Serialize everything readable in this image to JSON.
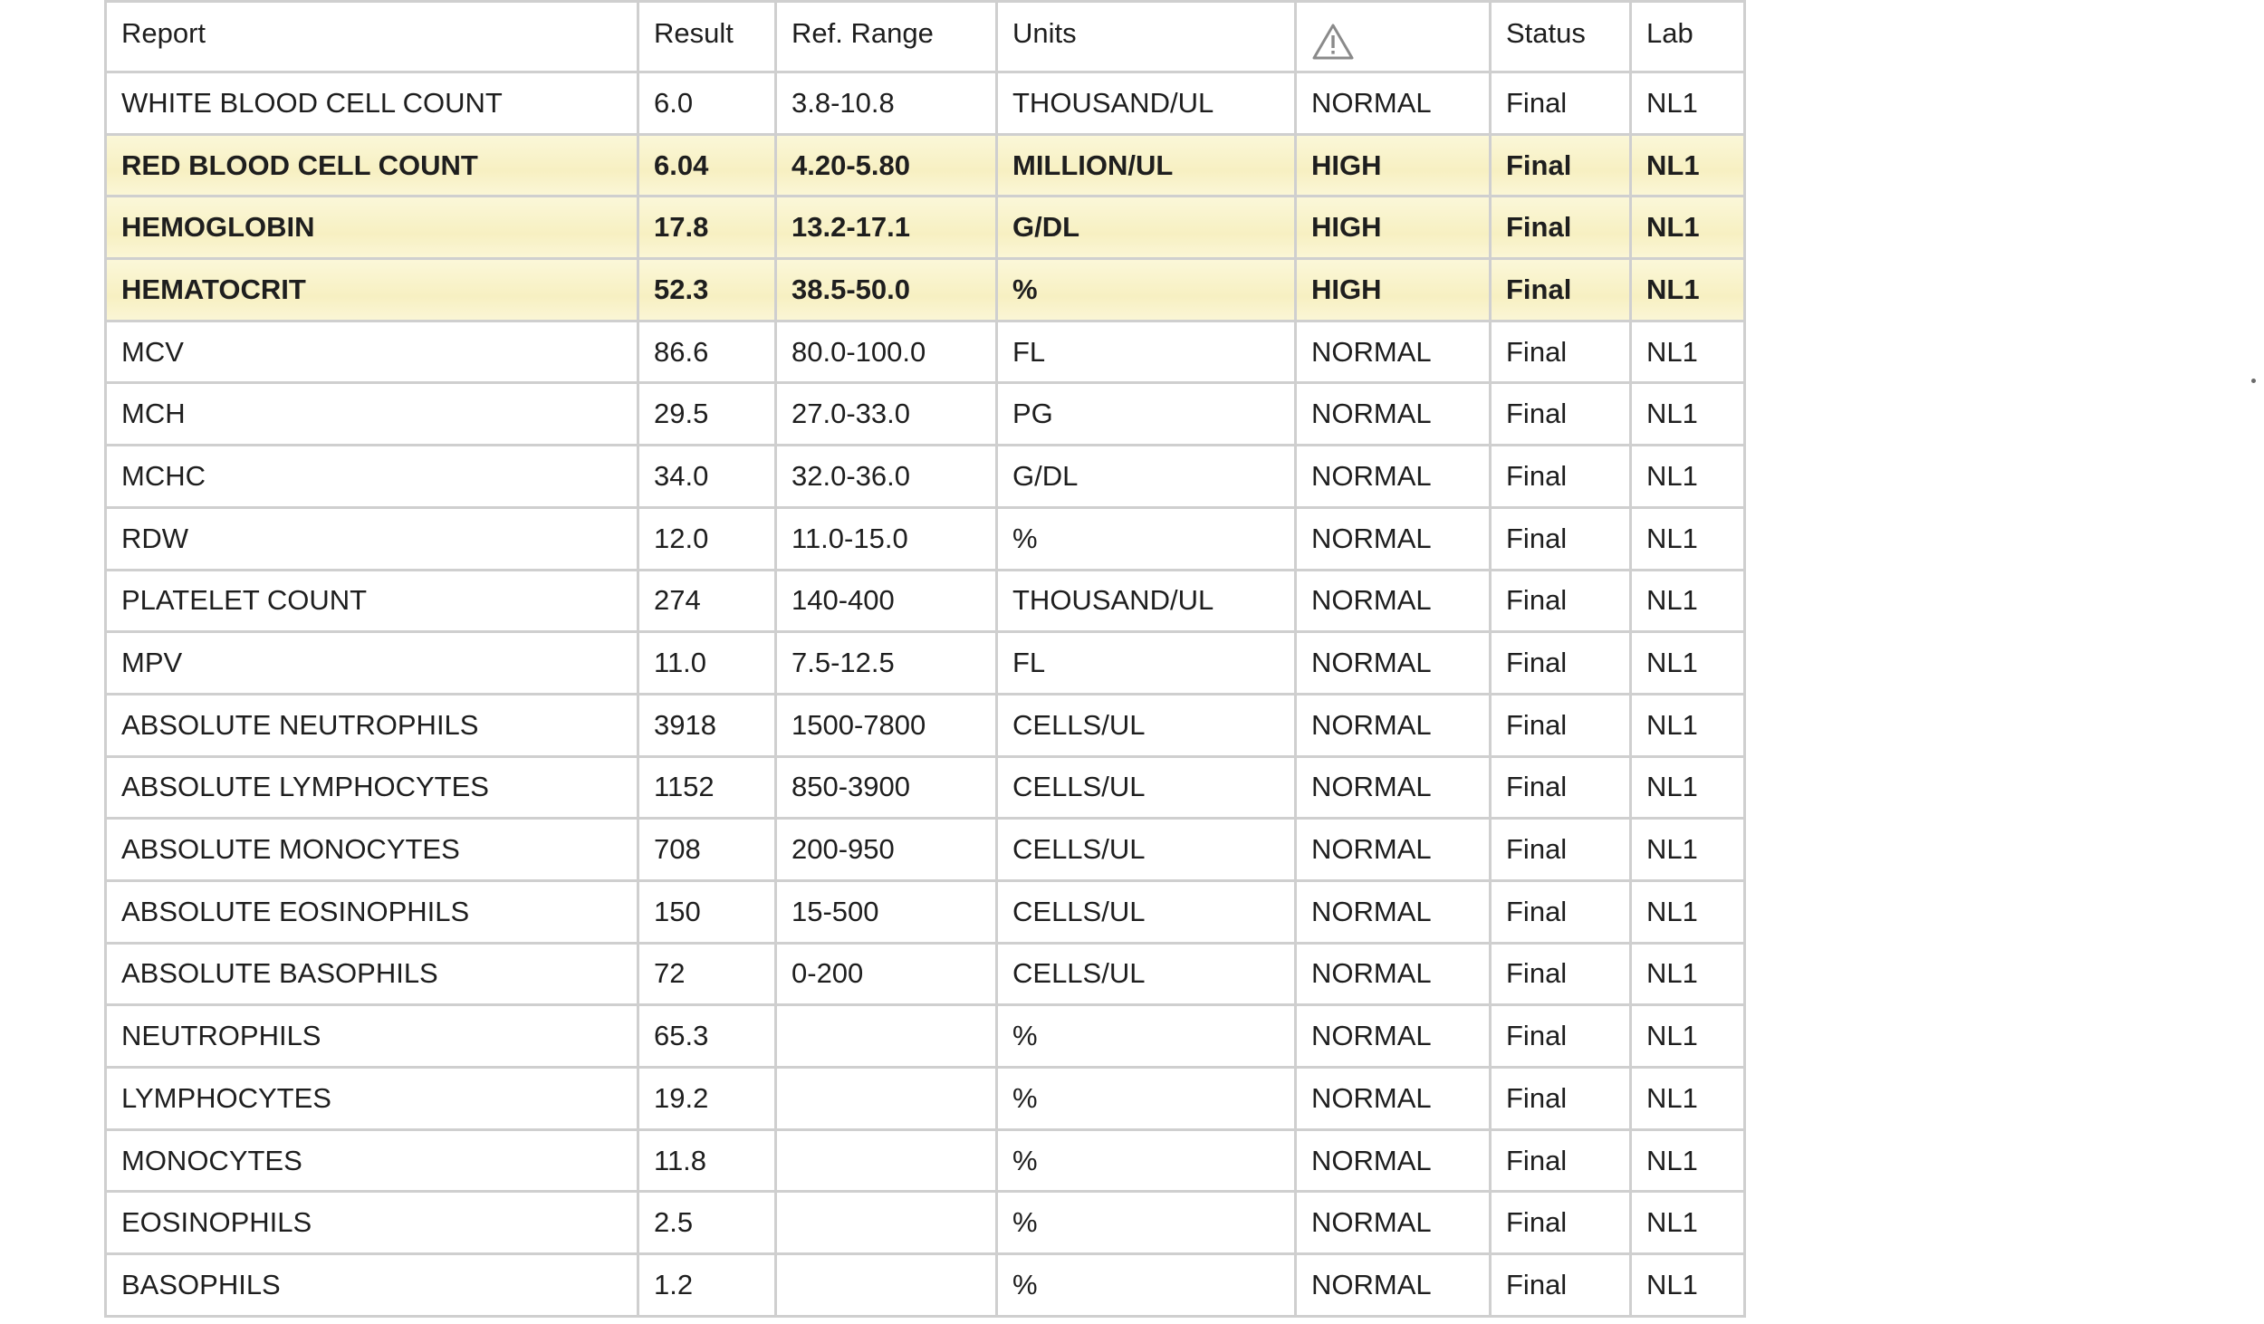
{
  "table": {
    "headers": {
      "report": "Report",
      "result": "Result",
      "ref_range": "Ref. Range",
      "units": "Units",
      "flag_icon": "warning-triangle-icon",
      "status": "Status",
      "lab": "Lab"
    },
    "rows": [
      {
        "report": "WHITE BLOOD CELL COUNT",
        "result": "6.0",
        "ref_range": "3.8-10.8",
        "units": "THOUSAND/UL",
        "flag": "NORMAL",
        "status": "Final",
        "lab": "NL1"
      },
      {
        "report": "RED BLOOD CELL COUNT",
        "result": "6.04",
        "ref_range": "4.20-5.80",
        "units": "MILLION/UL",
        "flag": "HIGH",
        "status": "Final",
        "lab": "NL1"
      },
      {
        "report": "HEMOGLOBIN",
        "result": "17.8",
        "ref_range": "13.2-17.1",
        "units": "G/DL",
        "flag": "HIGH",
        "status": "Final",
        "lab": "NL1"
      },
      {
        "report": "HEMATOCRIT",
        "result": "52.3",
        "ref_range": "38.5-50.0",
        "units": "%",
        "flag": "HIGH",
        "status": "Final",
        "lab": "NL1"
      },
      {
        "report": "MCV",
        "result": "86.6",
        "ref_range": "80.0-100.0",
        "units": "FL",
        "flag": "NORMAL",
        "status": "Final",
        "lab": "NL1"
      },
      {
        "report": "MCH",
        "result": "29.5",
        "ref_range": "27.0-33.0",
        "units": "PG",
        "flag": "NORMAL",
        "status": "Final",
        "lab": "NL1"
      },
      {
        "report": "MCHC",
        "result": "34.0",
        "ref_range": "32.0-36.0",
        "units": "G/DL",
        "flag": "NORMAL",
        "status": "Final",
        "lab": "NL1"
      },
      {
        "report": "RDW",
        "result": "12.0",
        "ref_range": "11.0-15.0",
        "units": "%",
        "flag": "NORMAL",
        "status": "Final",
        "lab": "NL1"
      },
      {
        "report": "PLATELET COUNT",
        "result": "274",
        "ref_range": "140-400",
        "units": "THOUSAND/UL",
        "flag": "NORMAL",
        "status": "Final",
        "lab": "NL1"
      },
      {
        "report": "MPV",
        "result": "11.0",
        "ref_range": "7.5-12.5",
        "units": "FL",
        "flag": "NORMAL",
        "status": "Final",
        "lab": "NL1"
      },
      {
        "report": "ABSOLUTE NEUTROPHILS",
        "result": "3918",
        "ref_range": "1500-7800",
        "units": "CELLS/UL",
        "flag": "NORMAL",
        "status": "Final",
        "lab": "NL1"
      },
      {
        "report": "ABSOLUTE LYMPHOCYTES",
        "result": "1152",
        "ref_range": "850-3900",
        "units": "CELLS/UL",
        "flag": "NORMAL",
        "status": "Final",
        "lab": "NL1"
      },
      {
        "report": "ABSOLUTE MONOCYTES",
        "result": "708",
        "ref_range": "200-950",
        "units": "CELLS/UL",
        "flag": "NORMAL",
        "status": "Final",
        "lab": "NL1"
      },
      {
        "report": "ABSOLUTE EOSINOPHILS",
        "result": "150",
        "ref_range": "15-500",
        "units": "CELLS/UL",
        "flag": "NORMAL",
        "status": "Final",
        "lab": "NL1"
      },
      {
        "report": "ABSOLUTE BASOPHILS",
        "result": "72",
        "ref_range": "0-200",
        "units": "CELLS/UL",
        "flag": "NORMAL",
        "status": "Final",
        "lab": "NL1"
      },
      {
        "report": "NEUTROPHILS",
        "result": "65.3",
        "ref_range": "",
        "units": "%",
        "flag": "NORMAL",
        "status": "Final",
        "lab": "NL1"
      },
      {
        "report": "LYMPHOCYTES",
        "result": "19.2",
        "ref_range": "",
        "units": "%",
        "flag": "NORMAL",
        "status": "Final",
        "lab": "NL1"
      },
      {
        "report": "MONOCYTES",
        "result": "11.8",
        "ref_range": "",
        "units": "%",
        "flag": "NORMAL",
        "status": "Final",
        "lab": "NL1"
      },
      {
        "report": "EOSINOPHILS",
        "result": "2.5",
        "ref_range": "",
        "units": "%",
        "flag": "NORMAL",
        "status": "Final",
        "lab": "NL1"
      },
      {
        "report": "BASOPHILS",
        "result": "1.2",
        "ref_range": "",
        "units": "%",
        "flag": "NORMAL",
        "status": "Final",
        "lab": "NL1"
      }
    ]
  },
  "colors": {
    "highlight": "#f7f0c2",
    "grid": "#cfcfcf",
    "text": "#1e1e1e"
  }
}
